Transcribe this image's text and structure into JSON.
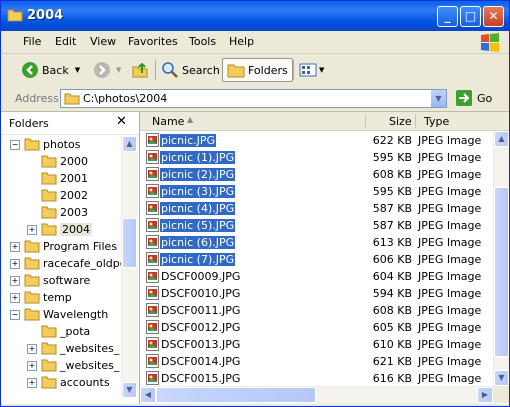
{
  "window": {
    "title": "2004"
  },
  "menu": [
    "File",
    "Edit",
    "View",
    "Favorites",
    "Tools",
    "Help"
  ],
  "toolbar": {
    "back": "Back",
    "search": "Search",
    "folders": "Folders"
  },
  "address": {
    "label": "Address",
    "value": "C:\\photos\\2004",
    "go": "Go"
  },
  "folders_pane": {
    "title": "Folders",
    "items": [
      {
        "label": "photos",
        "expander": "−"
      },
      {
        "label": "2000",
        "expander": ""
      },
      {
        "label": "2001",
        "expander": ""
      },
      {
        "label": "2002",
        "expander": ""
      },
      {
        "label": "2003",
        "expander": ""
      },
      {
        "label": "2004",
        "expander": "+"
      },
      {
        "label": "Program Files",
        "expander": "+"
      },
      {
        "label": "racecafe_oldpc",
        "expander": "+"
      },
      {
        "label": "software",
        "expander": "+"
      },
      {
        "label": "temp",
        "expander": "+"
      },
      {
        "label": "Wavelength",
        "expander": "−"
      },
      {
        "label": "_pota",
        "expander": ""
      },
      {
        "label": "_websites_",
        "expander": "+"
      },
      {
        "label": "_websites_",
        "expander": "+"
      },
      {
        "label": "accounts",
        "expander": "+"
      }
    ]
  },
  "file_list": {
    "columns": {
      "name": "Name",
      "size": "Size",
      "type": "Type"
    },
    "rows": [
      {
        "name": "picnic.JPG",
        "size": "622 KB",
        "type": "JPEG Image",
        "selected": true
      },
      {
        "name": "picnic (1).JPG",
        "size": "595 KB",
        "type": "JPEG Image",
        "selected": true
      },
      {
        "name": "picnic (2).JPG",
        "size": "608 KB",
        "type": "JPEG Image",
        "selected": true
      },
      {
        "name": "picnic (3).JPG",
        "size": "595 KB",
        "type": "JPEG Image",
        "selected": true
      },
      {
        "name": "picnic (4).JPG",
        "size": "587 KB",
        "type": "JPEG Image",
        "selected": true
      },
      {
        "name": "picnic (5).JPG",
        "size": "587 KB",
        "type": "JPEG Image",
        "selected": true
      },
      {
        "name": "picnic (6).JPG",
        "size": "613 KB",
        "type": "JPEG Image",
        "selected": true
      },
      {
        "name": "picnic (7).JPG",
        "size": "606 KB",
        "type": "JPEG Image",
        "selected": true
      },
      {
        "name": "DSCF0009.JPG",
        "size": "604 KB",
        "type": "JPEG Image",
        "selected": false
      },
      {
        "name": "DSCF0010.JPG",
        "size": "594 KB",
        "type": "JPEG Image",
        "selected": false
      },
      {
        "name": "DSCF0011.JPG",
        "size": "608 KB",
        "type": "JPEG Image",
        "selected": false
      },
      {
        "name": "DSCF0012.JPG",
        "size": "605 KB",
        "type": "JPEG Image",
        "selected": false
      },
      {
        "name": "DSCF0013.JPG",
        "size": "610 KB",
        "type": "JPEG Image",
        "selected": false
      },
      {
        "name": "DSCF0014.JPG",
        "size": "621 KB",
        "type": "JPEG Image",
        "selected": false
      },
      {
        "name": "DSCF0015.JPG",
        "size": "616 KB",
        "type": "JPEG Image",
        "selected": false
      }
    ]
  },
  "colors": {
    "selection": "#316ac5",
    "titlebar": "#0a5fe8",
    "folder": "#f2cd5c"
  }
}
